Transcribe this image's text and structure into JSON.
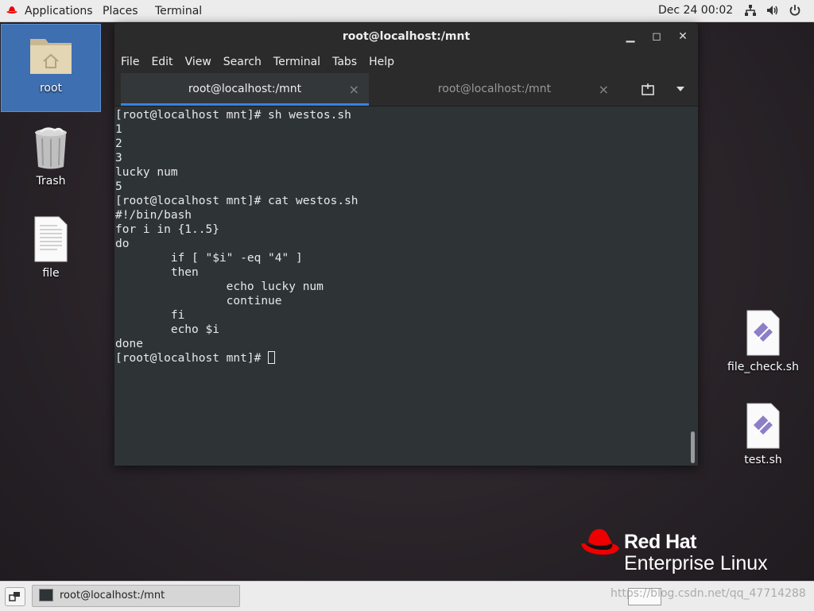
{
  "topbar": {
    "applications": "Applications",
    "places": "Places",
    "terminal": "Terminal",
    "clock": "Dec 24  00:02",
    "icons": [
      "network-icon",
      "volume-icon",
      "power-icon"
    ]
  },
  "desktop": {
    "root": "root",
    "trash": "Trash",
    "file": "file",
    "file_check": "file_check.sh",
    "test": "test.sh"
  },
  "window": {
    "title": "root@localhost:/mnt",
    "min": "▁",
    "max": "◻",
    "close": "✕",
    "menu": [
      "File",
      "Edit",
      "View",
      "Search",
      "Terminal",
      "Tabs",
      "Help"
    ],
    "tabs": [
      {
        "label": "root@localhost:/mnt",
        "close": "×"
      },
      {
        "label": "root@localhost:/mnt",
        "close": "×"
      }
    ]
  },
  "terminal": {
    "output": "[root@localhost mnt]# sh westos.sh\n1\n2\n3\nlucky num\n5\n[root@localhost mnt]# cat westos.sh\n#!/bin/bash\nfor i in {1..5}\ndo\n        if [ \"$i\" -eq \"4\" ]\n        then\n                echo lucky num\n                continue\n        fi\n        echo $i\ndone\n[root@localhost mnt]# "
  },
  "logo": {
    "line1": "Red Hat",
    "line2": "Enterprise Linux"
  },
  "taskbar": {
    "item": "root@localhost:/mnt"
  },
  "watermark": "https://blog.csdn.net/qq_47714288",
  "colors": {
    "accent": "#3584e4",
    "terminal_bg": "#2e3436",
    "redhat_red": "#ee0000"
  }
}
